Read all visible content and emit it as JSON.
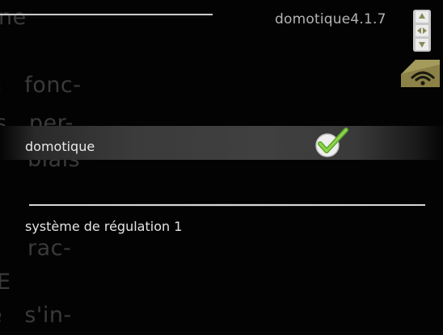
{
  "header": {
    "title": "domotique4.1.7"
  },
  "menu": {
    "items": [
      {
        "label": "domotique",
        "selected": true,
        "checked": true
      },
      {
        "label": "système de régulation 1",
        "selected": false
      }
    ]
  },
  "background_text": {
    "lines": [
      "ne",
      "a   fonc-",
      "ls   per-",
      "biais",
      "rac-",
      "E",
      "e   s'in-"
    ]
  },
  "icons": {
    "dpad": "navigation-dpad-icon",
    "wifi": "wifi-icon",
    "check": "checkmark-icon"
  },
  "colors": {
    "background": "#030303",
    "text": "#e9e9e9",
    "check_green": "#7cc93a",
    "wifi_tile": "#8a7f43"
  }
}
